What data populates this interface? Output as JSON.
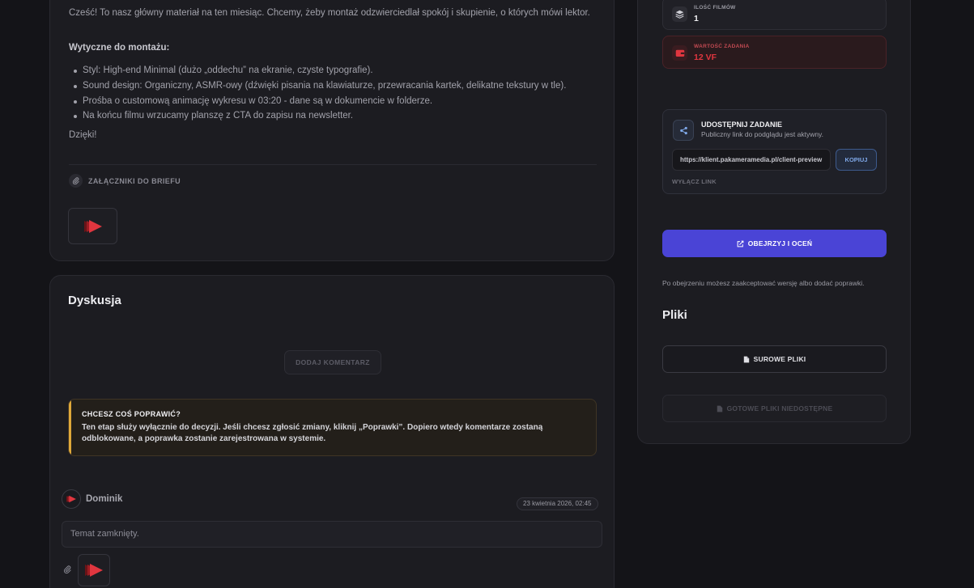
{
  "brief": {
    "intro": "Cześć! To nasz główny materiał na ten miesiąc. Chcemy, żeby montaż odzwierciedlał spokój i skupienie, o których mówi lektor.",
    "guidelines_heading": "Wytyczne do montażu:",
    "guidelines": [
      "Styl: High-end Minimal (dużo „oddechu” na ekranie, czyste typografie).",
      "Sound design: Organiczny, ASMR-owy (dźwięki pisania na klawiaturze, przewracania kartek, delikatne tekstury w tle).",
      "Prośba o customową animację wykresu w 03:20 - dane są w dokumencie w folderze.",
      "Na końcu filmu wrzucamy planszę z CTA do zapisu na newsletter."
    ],
    "thanks": "Dzięki!",
    "attachments_label": "ZAŁĄCZNIKI DO BRIEFU"
  },
  "discussion": {
    "title": "Dyskusja",
    "add_comment_label": "DODAJ KOMENTARZ",
    "notice_title": "CHCESZ COŚ POPRAWIĆ?",
    "notice_text": "Ten etap służy wyłącznie do decyzji. Jeśli chcesz zgłosić zmiany, kliknij „Poprawki”. Dopiero wtedy komentarze zostaną odblokowane, a poprawka zostanie zarejestrowana w systemie.",
    "comment": {
      "author": "Dominik",
      "date": "23 kwietnia 2026, 02:45",
      "text": "Temat zamknięty."
    }
  },
  "sidebar": {
    "films_label": "ILOŚĆ FILMÓW",
    "films_value": "1",
    "task_value_label": "WARTOŚĆ ZADANIA",
    "task_value": "12 VF",
    "share": {
      "title": "UDOSTĘPNIJ ZADANIE",
      "subtitle": "Publiczny link do podglądu jest aktywny.",
      "url": "https://klient.pakameramedia.pl/client-preview",
      "copy_label": "KOPIUJ",
      "disable_label": "WYŁĄCZ LINK"
    },
    "watch_label": "OBEJRZYJ I OCEŃ",
    "watch_note": "Po obejrzeniu możesz zaakceptować wersję albo dodać poprawki.",
    "files_title": "Pliki",
    "raw_files_label": "SUROWE PLIKI",
    "ready_files_label": "GOTOWE PLIKI NIEDOSTĘPNE"
  },
  "colors": {
    "background": "#141418",
    "card": "#1c1c21",
    "accent": "#4a44d6",
    "warning": "#e0a93a",
    "danger": "#e0363f",
    "link": "#7fa8e8"
  }
}
